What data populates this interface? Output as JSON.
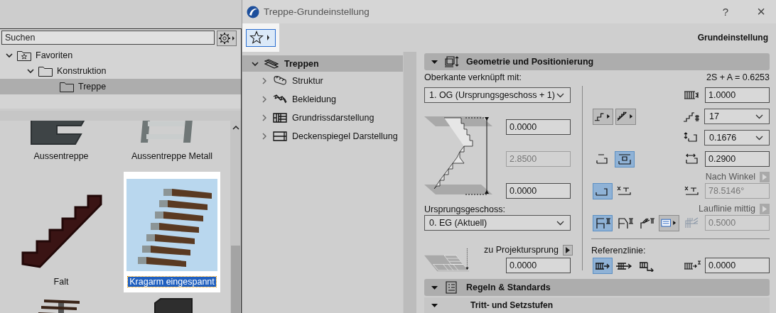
{
  "library_panel": {
    "search": {
      "placeholder": "Suchen"
    },
    "tree": [
      {
        "label": "Favoriten",
        "expanded": true,
        "selected": false,
        "children": [
          {
            "label": "Konstruktion",
            "expanded": true,
            "selected": false,
            "children": [
              {
                "label": "Treppe",
                "selected": true
              }
            ]
          }
        ]
      }
    ],
    "gallery": [
      {
        "kind": "concrete",
        "label": "Aussentreppe",
        "selected": false
      },
      {
        "kind": "metal",
        "label": "Aussentreppe Metall",
        "selected": false
      },
      {
        "kind": "wood",
        "label": "Falt",
        "selected": false
      },
      {
        "kind": "cantilever",
        "label": "Kragarm eingespannt",
        "selected": true
      },
      {
        "kind": "beam",
        "selected": false
      },
      {
        "kind": "block",
        "selected": false
      }
    ]
  },
  "dialog": {
    "title": "Treppe-Grundeinstellung",
    "help": "?",
    "close": "×",
    "heading": "Grundeinstellung",
    "nav": [
      {
        "label": "Treppen",
        "selected": true,
        "expanded": true,
        "children": [
          {
            "label": "Struktur",
            "expanded": false
          },
          {
            "label": "Bekleidung",
            "expanded": false
          },
          {
            "label": "Grundrissdarstellung",
            "expanded": false
          },
          {
            "label": "Deckenspiegel Darstellung",
            "expanded": false
          }
        ]
      }
    ],
    "geometry": {
      "title": "Geometrie und Positionierung",
      "expanded": true,
      "top_link": {
        "label": "Oberkante verknüpft mit:",
        "value": "1. OG (Ursprungsgeschoss + 1)"
      },
      "formula": "2S + A = 0.6253",
      "top_offset": {
        "value": "0.0000",
        "disabled": false
      },
      "height": {
        "value": "2.8500",
        "disabled": true
      },
      "bottom_offset": {
        "value": "0.0000",
        "disabled": false
      },
      "home_story": {
        "label": "Ursprungsgeschoss:",
        "value": "0. EG (Aktuell)"
      },
      "origin": {
        "label": "zu Projektursprung",
        "value": "0.0000",
        "disabled": false
      },
      "flight_width": {
        "value": "1.0000",
        "disabled": false
      },
      "risers": {
        "value": "17"
      },
      "riser_height": {
        "value": "0.1676"
      },
      "tread_depth": {
        "value": "0.2900",
        "disabled": false
      },
      "tread_buttons": [
        {
          "selected": false
        },
        {
          "selected": true
        }
      ],
      "angle_mode": {
        "label": "Nach Winkel"
      },
      "angle_buttons": [
        {
          "selected": true
        },
        {
          "selected": false
        }
      ],
      "angle": {
        "value": "78.5146°",
        "disabled": true
      },
      "walkline_mode": {
        "label": "Lauflinie mittig"
      },
      "walkline_buttons": [
        {
          "selected": true
        },
        {
          "selected": false
        },
        {
          "selected": false
        }
      ],
      "walkline_offset": {
        "value": "0.5000",
        "disabled": true
      },
      "reference": {
        "label": "Referenzlinie:",
        "buttons": [
          {
            "selected": true
          },
          {
            "selected": false
          },
          {
            "selected": false
          }
        ],
        "offset": {
          "value": "0.0000",
          "disabled": false
        }
      }
    },
    "rules": {
      "title": "Regeln & Standards",
      "expanded": true,
      "subsection": {
        "title": "Tritt- und Setzstufen",
        "expanded": true
      }
    }
  }
}
